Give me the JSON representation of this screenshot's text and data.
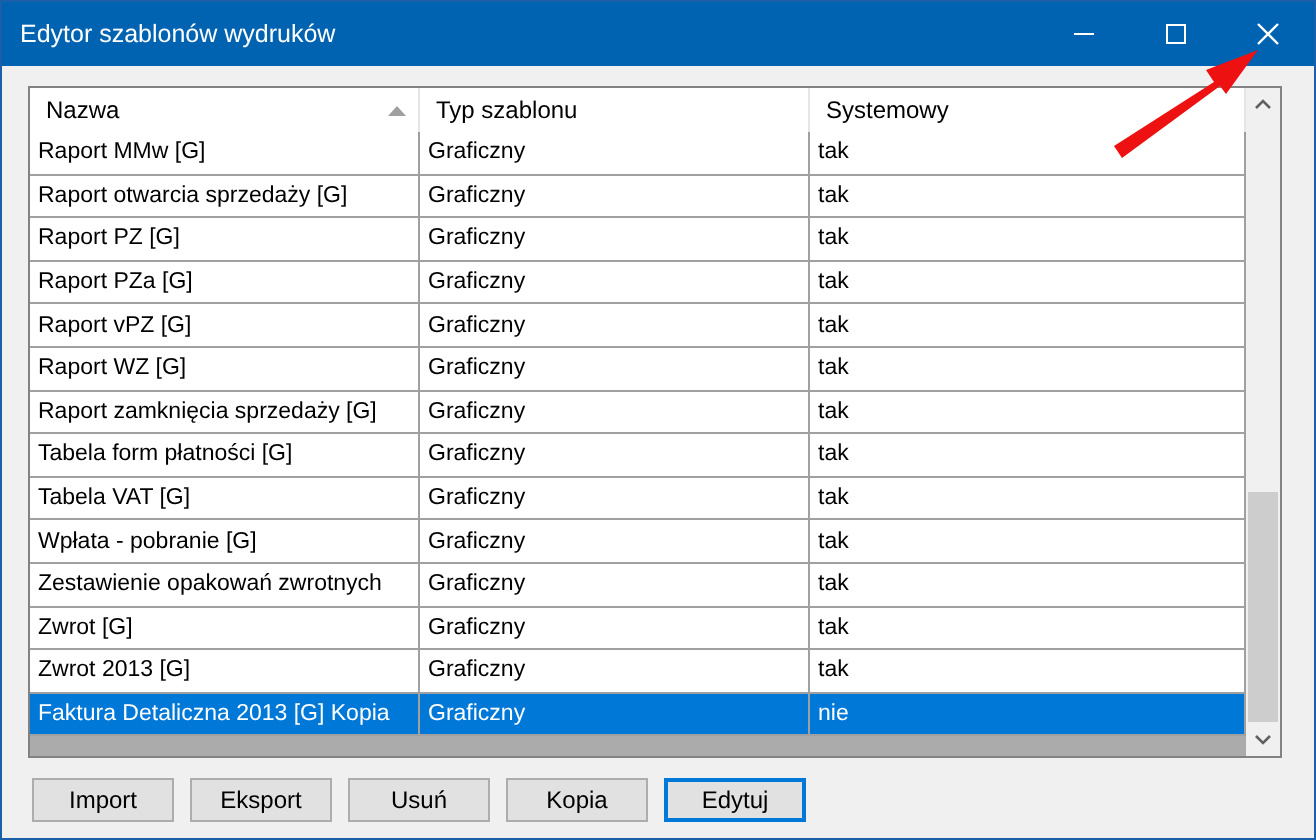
{
  "window": {
    "title": "Edytor szablonów wydruków"
  },
  "table": {
    "columns": [
      {
        "label": "Nazwa",
        "sorted": true
      },
      {
        "label": "Typ szablonu",
        "sorted": false
      },
      {
        "label": "Systemowy",
        "sorted": false
      }
    ],
    "rows": [
      {
        "cells": [
          "Raport MMw [G]",
          "Graficzny",
          "tak"
        ],
        "selected": false
      },
      {
        "cells": [
          "Raport otwarcia sprzedaży [G]",
          "Graficzny",
          "tak"
        ],
        "selected": false
      },
      {
        "cells": [
          "Raport PZ [G]",
          "Graficzny",
          "tak"
        ],
        "selected": false
      },
      {
        "cells": [
          "Raport PZa [G]",
          "Graficzny",
          "tak"
        ],
        "selected": false
      },
      {
        "cells": [
          "Raport vPZ [G]",
          "Graficzny",
          "tak"
        ],
        "selected": false
      },
      {
        "cells": [
          "Raport WZ [G]",
          "Graficzny",
          "tak"
        ],
        "selected": false
      },
      {
        "cells": [
          "Raport zamknięcia sprzedaży [G]",
          "Graficzny",
          "tak"
        ],
        "selected": false
      },
      {
        "cells": [
          "Tabela form płatności [G]",
          "Graficzny",
          "tak"
        ],
        "selected": false
      },
      {
        "cells": [
          "Tabela VAT [G]",
          "Graficzny",
          "tak"
        ],
        "selected": false
      },
      {
        "cells": [
          "Wpłata - pobranie [G]",
          "Graficzny",
          "tak"
        ],
        "selected": false
      },
      {
        "cells": [
          "Zestawienie opakowań zwrotnych",
          "Graficzny",
          "tak"
        ],
        "selected": false
      },
      {
        "cells": [
          "Zwrot [G]",
          "Graficzny",
          "tak"
        ],
        "selected": false
      },
      {
        "cells": [
          "Zwrot 2013 [G]",
          "Graficzny",
          "tak"
        ],
        "selected": false
      },
      {
        "cells": [
          "Faktura Detaliczna 2013 [G] Kopia",
          "Graficzny",
          "nie"
        ],
        "selected": true
      }
    ]
  },
  "buttons": [
    {
      "label": "Import",
      "focused": false
    },
    {
      "label": "Eksport",
      "focused": false
    },
    {
      "label": "Usuń",
      "focused": false
    },
    {
      "label": "Kopia",
      "focused": false
    },
    {
      "label": "Edytuj",
      "focused": true
    }
  ]
}
